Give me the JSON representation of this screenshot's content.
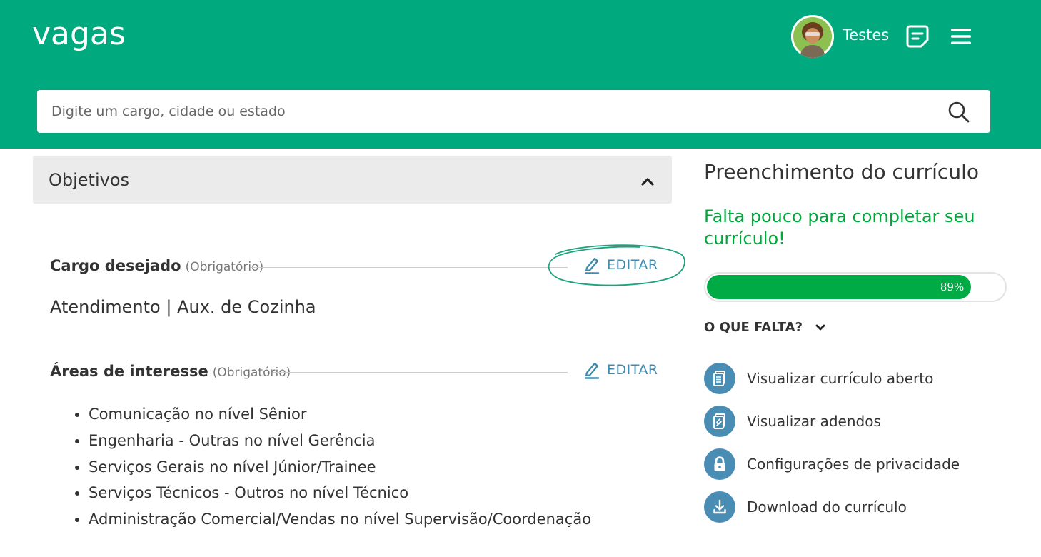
{
  "header": {
    "logo": "vagas",
    "user_name": "Testes",
    "search_placeholder": "Digite um cargo, cidade ou estado"
  },
  "section": {
    "title": "Objetivos"
  },
  "cargo": {
    "label": "Cargo desejado",
    "hint": "(Obrigatório)",
    "edit_label": "EDITAR",
    "value": "Atendimento | Aux. de Cozinha"
  },
  "areas": {
    "label": "Áreas de interesse",
    "hint": "(Obrigatório)",
    "edit_label": "EDITAR",
    "items": [
      "Comunicação no nível Sênior",
      "Engenharia - Outras no nível Gerência",
      "Serviços Gerais no nível Júnior/Trainee",
      "Serviços Técnicos - Outros no nível Técnico",
      "Administração Comercial/Vendas no nível Supervisão/Coordenação"
    ]
  },
  "sidebar": {
    "title": "Preenchimento do currículo",
    "message": "Falta pouco para completar seu currículo!",
    "progress_percent": 89,
    "progress_label": "89%",
    "missing_label": "O QUE FALTA?",
    "actions": [
      {
        "label": "Visualizar currículo aberto",
        "icon": "document-icon"
      },
      {
        "label": "Visualizar adendos",
        "icon": "attachment-document-icon"
      },
      {
        "label": "Configurações de privacidade",
        "icon": "lock-icon"
      },
      {
        "label": "Download do currículo",
        "icon": "download-icon"
      }
    ]
  },
  "colors": {
    "brand_green": "#00a97e",
    "progress_green": "#00aa44",
    "message_green": "#00a83c",
    "link_blue": "#3f8bb0",
    "icon_blue": "#4a8db4"
  }
}
